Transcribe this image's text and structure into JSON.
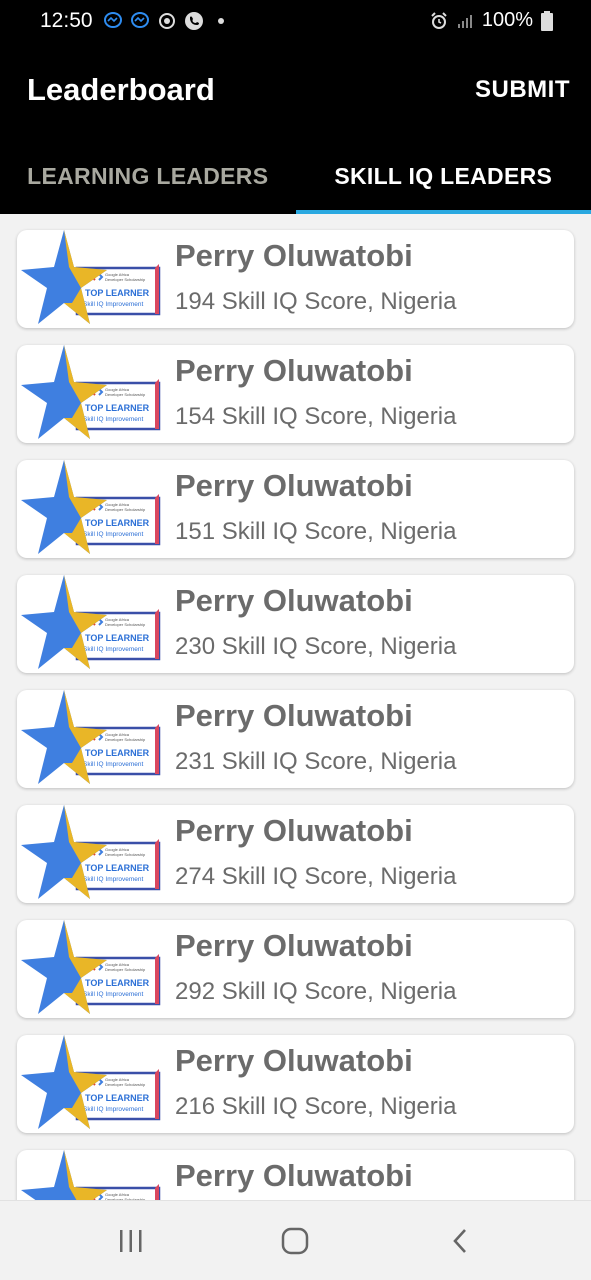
{
  "status_bar": {
    "time": "12:50",
    "battery": "100%",
    "icons": [
      "messenger-icon",
      "messenger-icon",
      "sync-icon",
      "phone-icon",
      "dot-icon",
      "alarm-icon",
      "signal-icon",
      "battery-icon"
    ]
  },
  "app_bar": {
    "title": "Leaderboard",
    "submit_label": "SUBMIT"
  },
  "tabs": [
    {
      "label": "LEARNING LEADERS",
      "active": false
    },
    {
      "label": "SKILL IQ LEADERS",
      "active": true
    }
  ],
  "badge": {
    "line1": "Google Africa",
    "line2": "Developer Scholarship",
    "title": "TOP LEARNER",
    "subtitle": "Skill IQ Improvement"
  },
  "leaders": [
    {
      "name": "Perry Oluwatobi",
      "detail": "194 Skill IQ Score, Nigeria"
    },
    {
      "name": "Perry Oluwatobi",
      "detail": "154 Skill IQ Score, Nigeria"
    },
    {
      "name": "Perry Oluwatobi",
      "detail": "151 Skill IQ Score, Nigeria"
    },
    {
      "name": "Perry Oluwatobi",
      "detail": "230 Skill IQ Score, Nigeria"
    },
    {
      "name": "Perry Oluwatobi",
      "detail": "231 Skill IQ Score, Nigeria"
    },
    {
      "name": "Perry Oluwatobi",
      "detail": "274 Skill IQ Score, Nigeria"
    },
    {
      "name": "Perry Oluwatobi",
      "detail": "292 Skill IQ Score, Nigeria"
    },
    {
      "name": "Perry Oluwatobi",
      "detail": "216 Skill IQ Score, Nigeria"
    },
    {
      "name": "Perry Oluwatobi",
      "detail": ""
    }
  ],
  "nav": [
    "recents-icon",
    "home-icon",
    "back-icon"
  ],
  "colors": {
    "bar_bg": "#000000",
    "tab_indicator": "#29a8e0",
    "text_gray": "#6b6b6b",
    "star_blue": "#3f7fe0",
    "star_yellow": "#f2b91c"
  }
}
